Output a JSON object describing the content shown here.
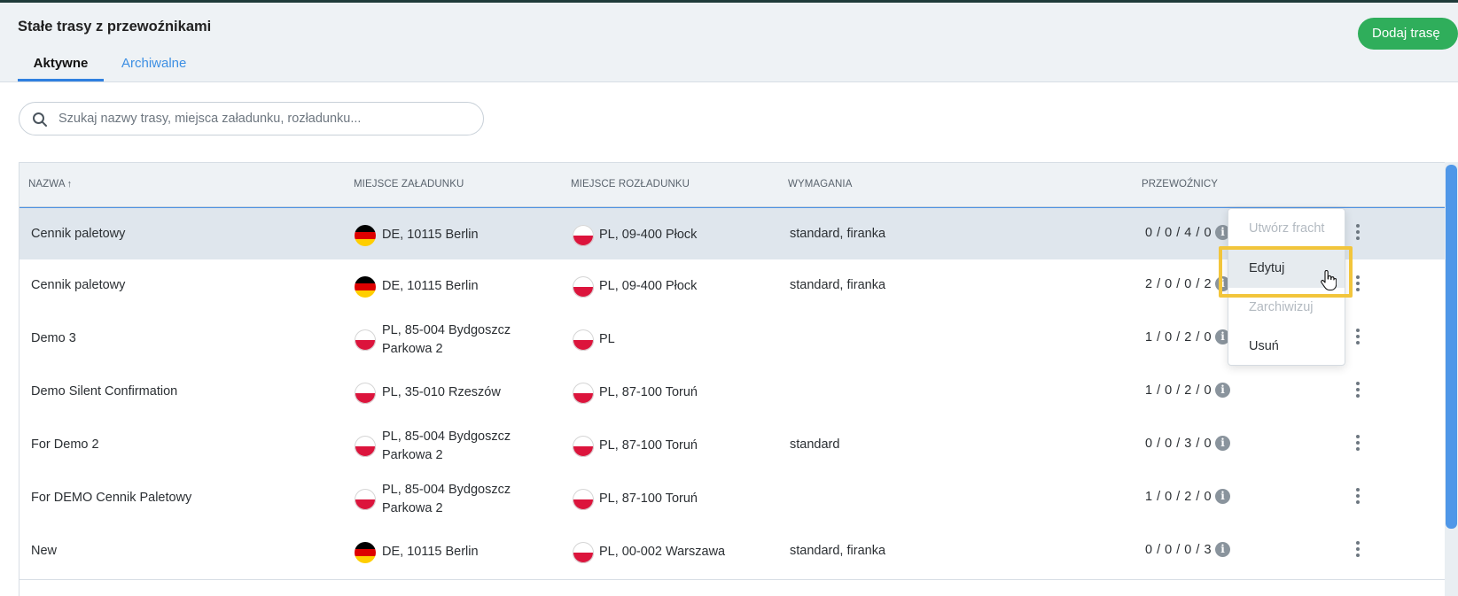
{
  "header": {
    "title": "Stałe trasy z przewoźnikami",
    "add_button": "Dodaj trasę",
    "tabs": [
      {
        "label": "Aktywne",
        "active": true
      },
      {
        "label": "Archiwalne",
        "active": false
      }
    ]
  },
  "search": {
    "placeholder": "Szukaj nazwy trasy, miejsca załadunku, rozładunku..."
  },
  "table": {
    "columns": {
      "name": "NAZWA",
      "loading": "MIEJSCE ZAŁADUNKU",
      "unloading": "MIEJSCE ROZŁADUNKU",
      "requirements": "WYMAGANIA",
      "carriers": "PRZEWOŹNICY"
    },
    "sort_indicator": "↑",
    "rows": [
      {
        "name": "Cennik paletowy",
        "loading_flag": "de",
        "loading_line1": "DE, 10115 Berlin",
        "loading_line2": "",
        "unloading_flag": "pl",
        "unloading": "PL, 09-400 Płock",
        "requirements": "standard, firanka",
        "carriers": "0 / 0 / 4 / 0"
      },
      {
        "name": "Cennik paletowy",
        "loading_flag": "de",
        "loading_line1": "DE, 10115 Berlin",
        "loading_line2": "",
        "unloading_flag": "pl",
        "unloading": "PL, 09-400 Płock",
        "requirements": "standard, firanka",
        "carriers": "2 / 0 / 0 / 2"
      },
      {
        "name": "Demo 3",
        "loading_flag": "pl",
        "loading_line1": "PL, 85-004 Bydgoszcz",
        "loading_line2": "Parkowa 2",
        "unloading_flag": "pl",
        "unloading": "PL",
        "requirements": "",
        "carriers": "1 / 0 / 2 / 0"
      },
      {
        "name": "Demo Silent Confirmation",
        "loading_flag": "pl",
        "loading_line1": "PL, 35-010 Rzeszów",
        "loading_line2": "",
        "unloading_flag": "pl",
        "unloading": "PL, 87-100 Toruń",
        "requirements": "",
        "carriers": "1 / 0 / 2 / 0"
      },
      {
        "name": "For Demo 2",
        "loading_flag": "pl",
        "loading_line1": "PL, 85-004 Bydgoszcz",
        "loading_line2": "Parkowa 2",
        "unloading_flag": "pl",
        "unloading": "PL, 87-100 Toruń",
        "requirements": "standard",
        "carriers": "0 / 0 / 3 / 0"
      },
      {
        "name": "For DEMO Cennik Paletowy",
        "loading_flag": "pl",
        "loading_line1": "PL, 85-004 Bydgoszcz",
        "loading_line2": "Parkowa 2",
        "unloading_flag": "pl",
        "unloading": "PL, 87-100 Toruń",
        "requirements": "",
        "carriers": "1 / 0 / 2 / 0"
      },
      {
        "name": "New",
        "loading_flag": "de",
        "loading_line1": "DE, 10115 Berlin",
        "loading_line2": "",
        "unloading_flag": "pl",
        "unloading": "PL, 00-002 Warszawa",
        "requirements": "standard, firanka",
        "carriers": "0 / 0 / 0 / 3"
      }
    ]
  },
  "context_menu": {
    "items": [
      {
        "label": "Utwórz fracht",
        "enabled": false
      },
      {
        "label": "Edytuj",
        "enabled": true,
        "hovered": true
      },
      {
        "label": "Zarchiwizuj",
        "enabled": false
      },
      {
        "label": "Usuń",
        "enabled": true
      }
    ]
  },
  "colors": {
    "accent": "#2f80e0",
    "add_button": "#2fae5b",
    "highlight": "#f2c53b",
    "selected_row": "#dfe6ed"
  }
}
